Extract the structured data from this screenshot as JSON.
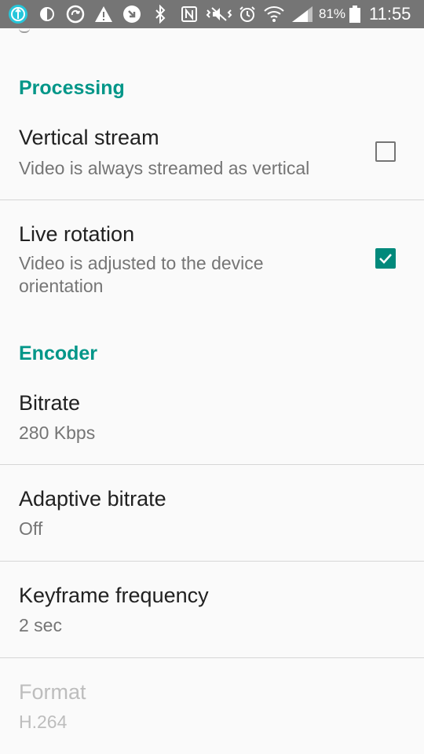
{
  "status_bar": {
    "battery_percent": "81%",
    "time": "11:55",
    "icons": [
      "app-notification-icon",
      "data-saver-icon",
      "sync-icon",
      "warning-icon",
      "messenger-icon",
      "bluetooth-icon",
      "nfc-icon",
      "vibrate-icon",
      "alarm-icon",
      "wifi-icon",
      "signal-icon",
      "battery-icon"
    ]
  },
  "colors": {
    "accent": "#009688",
    "checkbox_checked": "#00897b",
    "status_bar": "#757575"
  },
  "sections": {
    "processing": {
      "title": "Processing",
      "vertical_stream": {
        "title": "Vertical stream",
        "summary": "Video is always streamed as vertical",
        "checked": false
      },
      "live_rotation": {
        "title": "Live rotation",
        "summary": "Video is adjusted to the device orientation",
        "checked": true
      }
    },
    "encoder": {
      "title": "Encoder",
      "bitrate": {
        "title": "Bitrate",
        "summary": "280 Kbps"
      },
      "adaptive_bitrate": {
        "title": "Adaptive bitrate",
        "summary": "Off"
      },
      "keyframe_frequency": {
        "title": "Keyframe frequency",
        "summary": "2 sec"
      },
      "format": {
        "title": "Format",
        "summary": "H.264",
        "enabled": false
      }
    }
  }
}
